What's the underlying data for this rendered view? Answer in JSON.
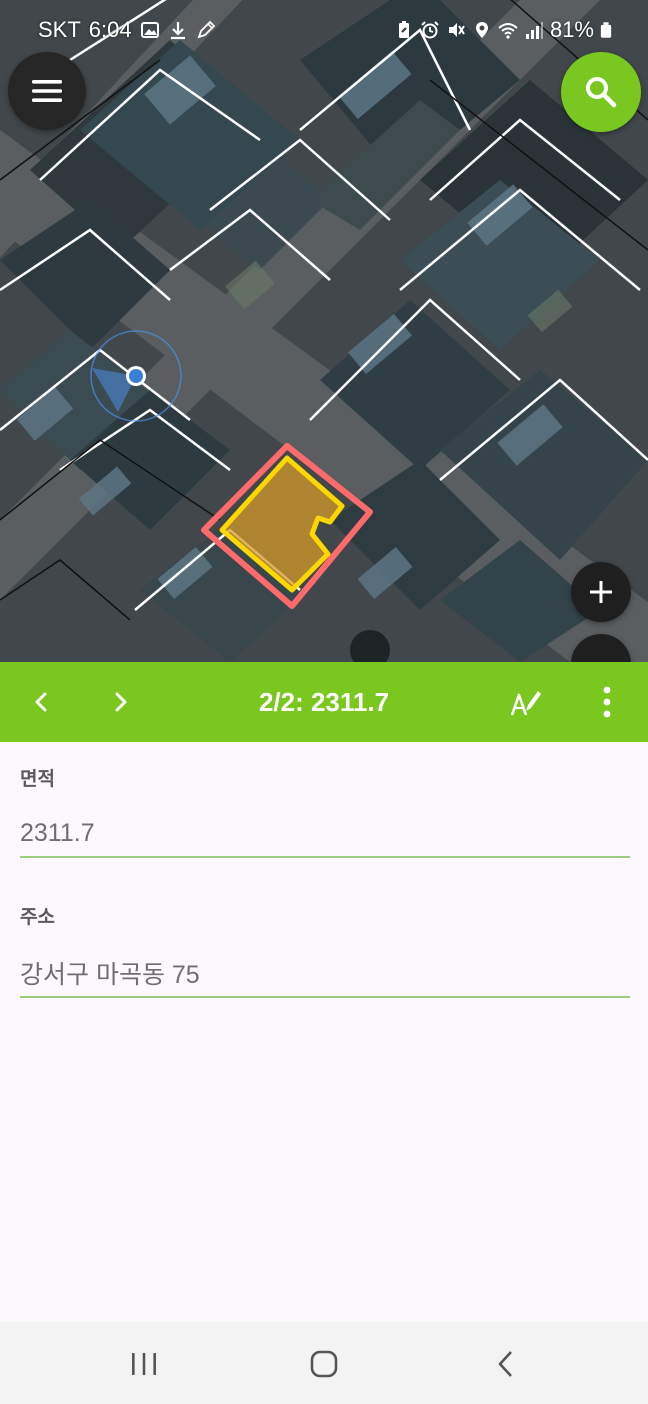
{
  "status_bar": {
    "carrier": "SKT",
    "time": "6:04",
    "battery": "81%",
    "left_icons": [
      "gallery-icon",
      "download-icon",
      "pen-icon"
    ],
    "right_icons": [
      "battery-saver-icon",
      "alarm-icon",
      "mute-icon",
      "location-icon",
      "wifi-icon",
      "signal-icon",
      "battery-icon"
    ]
  },
  "map": {
    "selected_outline_color": "#ff6b6b",
    "selected_fill_color": "#d49a2a",
    "selected_border_color": "#ffd700",
    "location_color": "#4a90e2"
  },
  "toolbar": {
    "title": "2/2: 2311.7",
    "color": "#7ac720",
    "prev_icon": "chevron-left-icon",
    "next_icon": "chevron-right-icon",
    "edit_icon": "text-edit-icon",
    "more_icon": "more-vert-icon"
  },
  "form": {
    "fields": [
      {
        "label": "면적",
        "value": "2311.7"
      },
      {
        "label": "주소",
        "value": "강서구 마곡동 75"
      }
    ]
  },
  "nav_bar": {
    "icons": [
      "recent-apps-icon",
      "home-icon",
      "back-icon"
    ]
  }
}
